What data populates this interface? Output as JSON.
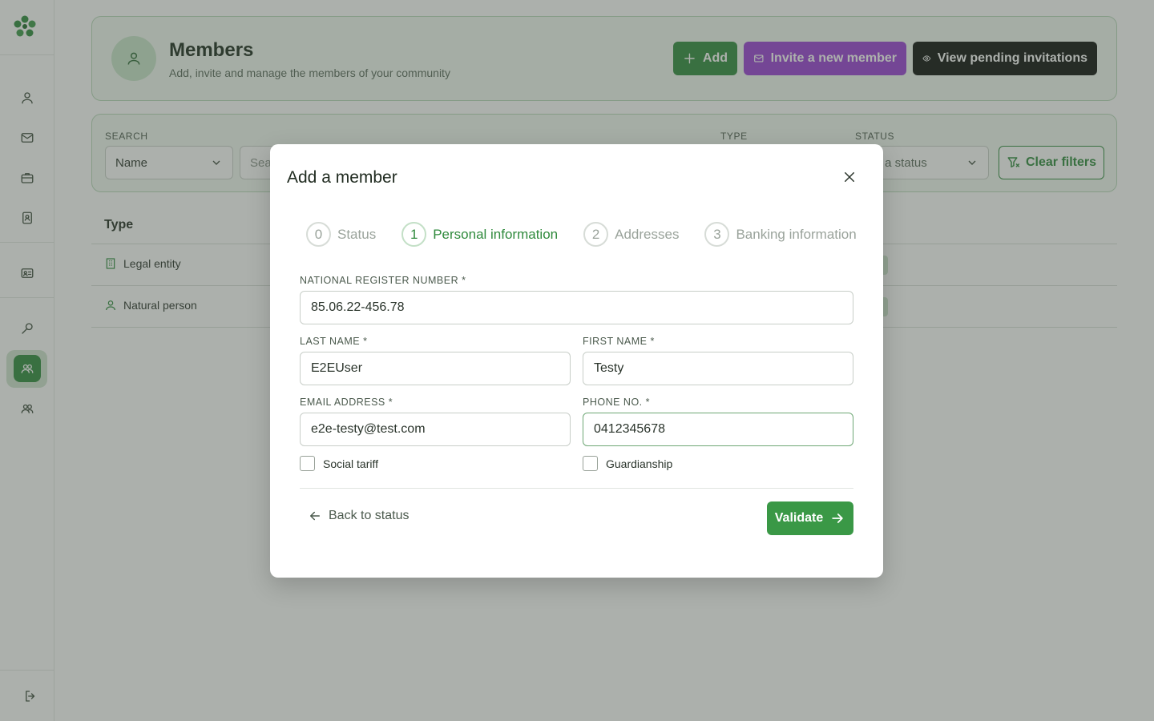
{
  "colors": {
    "primary": "#2f8a3c",
    "invite": "#9a3fd6",
    "dark": "#0c0f0c",
    "card_bg": "#f3faf3"
  },
  "sidebar": {
    "logo_icon": "clover-logo-icon",
    "items": [
      {
        "icon": "user-icon"
      },
      {
        "icon": "mail-icon"
      },
      {
        "icon": "briefcase-icon"
      },
      {
        "icon": "contact-book-icon"
      },
      {
        "icon": "id-card-icon"
      },
      {
        "icon": "search-key-icon"
      },
      {
        "icon": "members-icon",
        "active": true
      },
      {
        "icon": "group-icon"
      }
    ],
    "logout_icon": "logout-icon"
  },
  "header": {
    "title": "Members",
    "subtitle": "Add, invite and manage the members of your community",
    "add_label": "Add",
    "invite_label": "Invite a new member",
    "pending_label": "View pending invitations"
  },
  "filters": {
    "search_label": "SEARCH",
    "search_field_value": "Name",
    "search_placeholder": "Sea",
    "type_label": "TYPE",
    "status_label": "STATUS",
    "status_placeholder": "ect a status",
    "clear_label": "Clear filters"
  },
  "table": {
    "type_header": "Type",
    "rows": [
      {
        "type": "Legal entity",
        "icon": "building-icon"
      },
      {
        "type": "Natural person",
        "icon": "person-icon"
      }
    ]
  },
  "modal": {
    "title": "Add a member",
    "steps": [
      {
        "num": "0",
        "label": "Status"
      },
      {
        "num": "1",
        "label": "Personal information",
        "current": true
      },
      {
        "num": "2",
        "label": "Addresses"
      },
      {
        "num": "3",
        "label": "Banking information"
      }
    ],
    "fields": {
      "national_register": {
        "label": "NATIONAL REGISTER NUMBER *",
        "value": "85.06.22-456.78"
      },
      "last_name": {
        "label": "LAST NAME *",
        "value": "E2EUser"
      },
      "first_name": {
        "label": "FIRST NAME *",
        "value": "Testy"
      },
      "email": {
        "label": "EMAIL ADDRESS *",
        "value": "e2e-testy@test.com"
      },
      "phone": {
        "label": "PHONE NO. *",
        "value": "0412345678"
      }
    },
    "checkboxes": {
      "social_tariff": "Social tariff",
      "guardianship": "Guardianship"
    },
    "back_label": "Back to status",
    "validate_label": "Validate"
  }
}
